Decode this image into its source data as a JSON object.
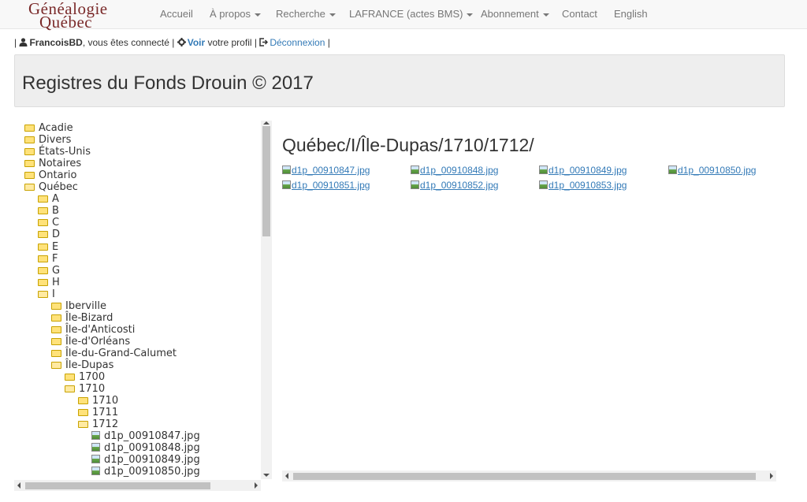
{
  "brand": {
    "line1": "Généalogie",
    "line2": "Québec",
    "color": "#7a2a2a"
  },
  "nav": {
    "items": [
      {
        "label": "Accueil",
        "dropdown": false
      },
      {
        "label": "À propos",
        "dropdown": true
      },
      {
        "label": "Recherche",
        "dropdown": true
      },
      {
        "label": "LAFRANCE (actes BMS)",
        "dropdown": true
      },
      {
        "label": "Abonnement",
        "dropdown": true
      },
      {
        "label": "Contact",
        "dropdown": false
      },
      {
        "label": "English",
        "dropdown": false
      }
    ]
  },
  "userbar": {
    "sep": "|",
    "user_icon": "user-icon",
    "username": "FrancoisBD",
    "connected_text": ", vous êtes connecté |",
    "gear_icon": "gear-icon",
    "voir": "Voir",
    "profil_text": "votre profil |",
    "logout_icon": "logout-icon",
    "logout": "Déconnexion",
    "end_sep": "|"
  },
  "page": {
    "title": "Registres du Fonds Drouin © 2017"
  },
  "tree": [
    {
      "label": "Acadie",
      "kind": "folder",
      "level": 0
    },
    {
      "label": "Divers",
      "kind": "folder",
      "level": 0
    },
    {
      "label": "États-Unis",
      "kind": "folder",
      "level": 0
    },
    {
      "label": "Notaires",
      "kind": "folder",
      "level": 0
    },
    {
      "label": "Ontario",
      "kind": "folder",
      "level": 0
    },
    {
      "label": "Québec",
      "kind": "folder-open",
      "level": 0
    },
    {
      "label": "A",
      "kind": "folder",
      "level": 1
    },
    {
      "label": "B",
      "kind": "folder",
      "level": 1
    },
    {
      "label": "C",
      "kind": "folder",
      "level": 1
    },
    {
      "label": "D",
      "kind": "folder",
      "level": 1
    },
    {
      "label": "E",
      "kind": "folder",
      "level": 1
    },
    {
      "label": "F",
      "kind": "folder",
      "level": 1
    },
    {
      "label": "G",
      "kind": "folder",
      "level": 1
    },
    {
      "label": "H",
      "kind": "folder",
      "level": 1
    },
    {
      "label": "I",
      "kind": "folder-open",
      "level": 1
    },
    {
      "label": "Iberville",
      "kind": "folder",
      "level": 2
    },
    {
      "label": "Île-Bizard",
      "kind": "folder",
      "level": 2
    },
    {
      "label": "Île-d'Anticosti",
      "kind": "folder",
      "level": 2
    },
    {
      "label": "Île-d'Orléans",
      "kind": "folder",
      "level": 2
    },
    {
      "label": "Île-du-Grand-Calumet",
      "kind": "folder",
      "level": 2
    },
    {
      "label": "Île-Dupas",
      "kind": "folder-open",
      "level": 2
    },
    {
      "label": "1700",
      "kind": "folder",
      "level": 3
    },
    {
      "label": "1710",
      "kind": "folder-open",
      "level": 3
    },
    {
      "label": "1710",
      "kind": "folder",
      "level": 4
    },
    {
      "label": "1711",
      "kind": "folder",
      "level": 4
    },
    {
      "label": "1712",
      "kind": "folder-open",
      "level": 4
    },
    {
      "label": "d1p_00910847.jpg",
      "kind": "image",
      "level": 5
    },
    {
      "label": "d1p_00910848.jpg",
      "kind": "image",
      "level": 5
    },
    {
      "label": "d1p_00910849.jpg",
      "kind": "image",
      "level": 5
    },
    {
      "label": "d1p_00910850.jpg",
      "kind": "image",
      "level": 5
    }
  ],
  "main": {
    "path": "Québec/I/Île-Dupas/1710/1712/",
    "files": [
      "d1p_00910847.jpg",
      "d1p_00910848.jpg",
      "d1p_00910849.jpg",
      "d1p_00910850.jpg",
      "d1p_00910851.jpg",
      "d1p_00910852.jpg",
      "d1p_00910853.jpg"
    ]
  }
}
